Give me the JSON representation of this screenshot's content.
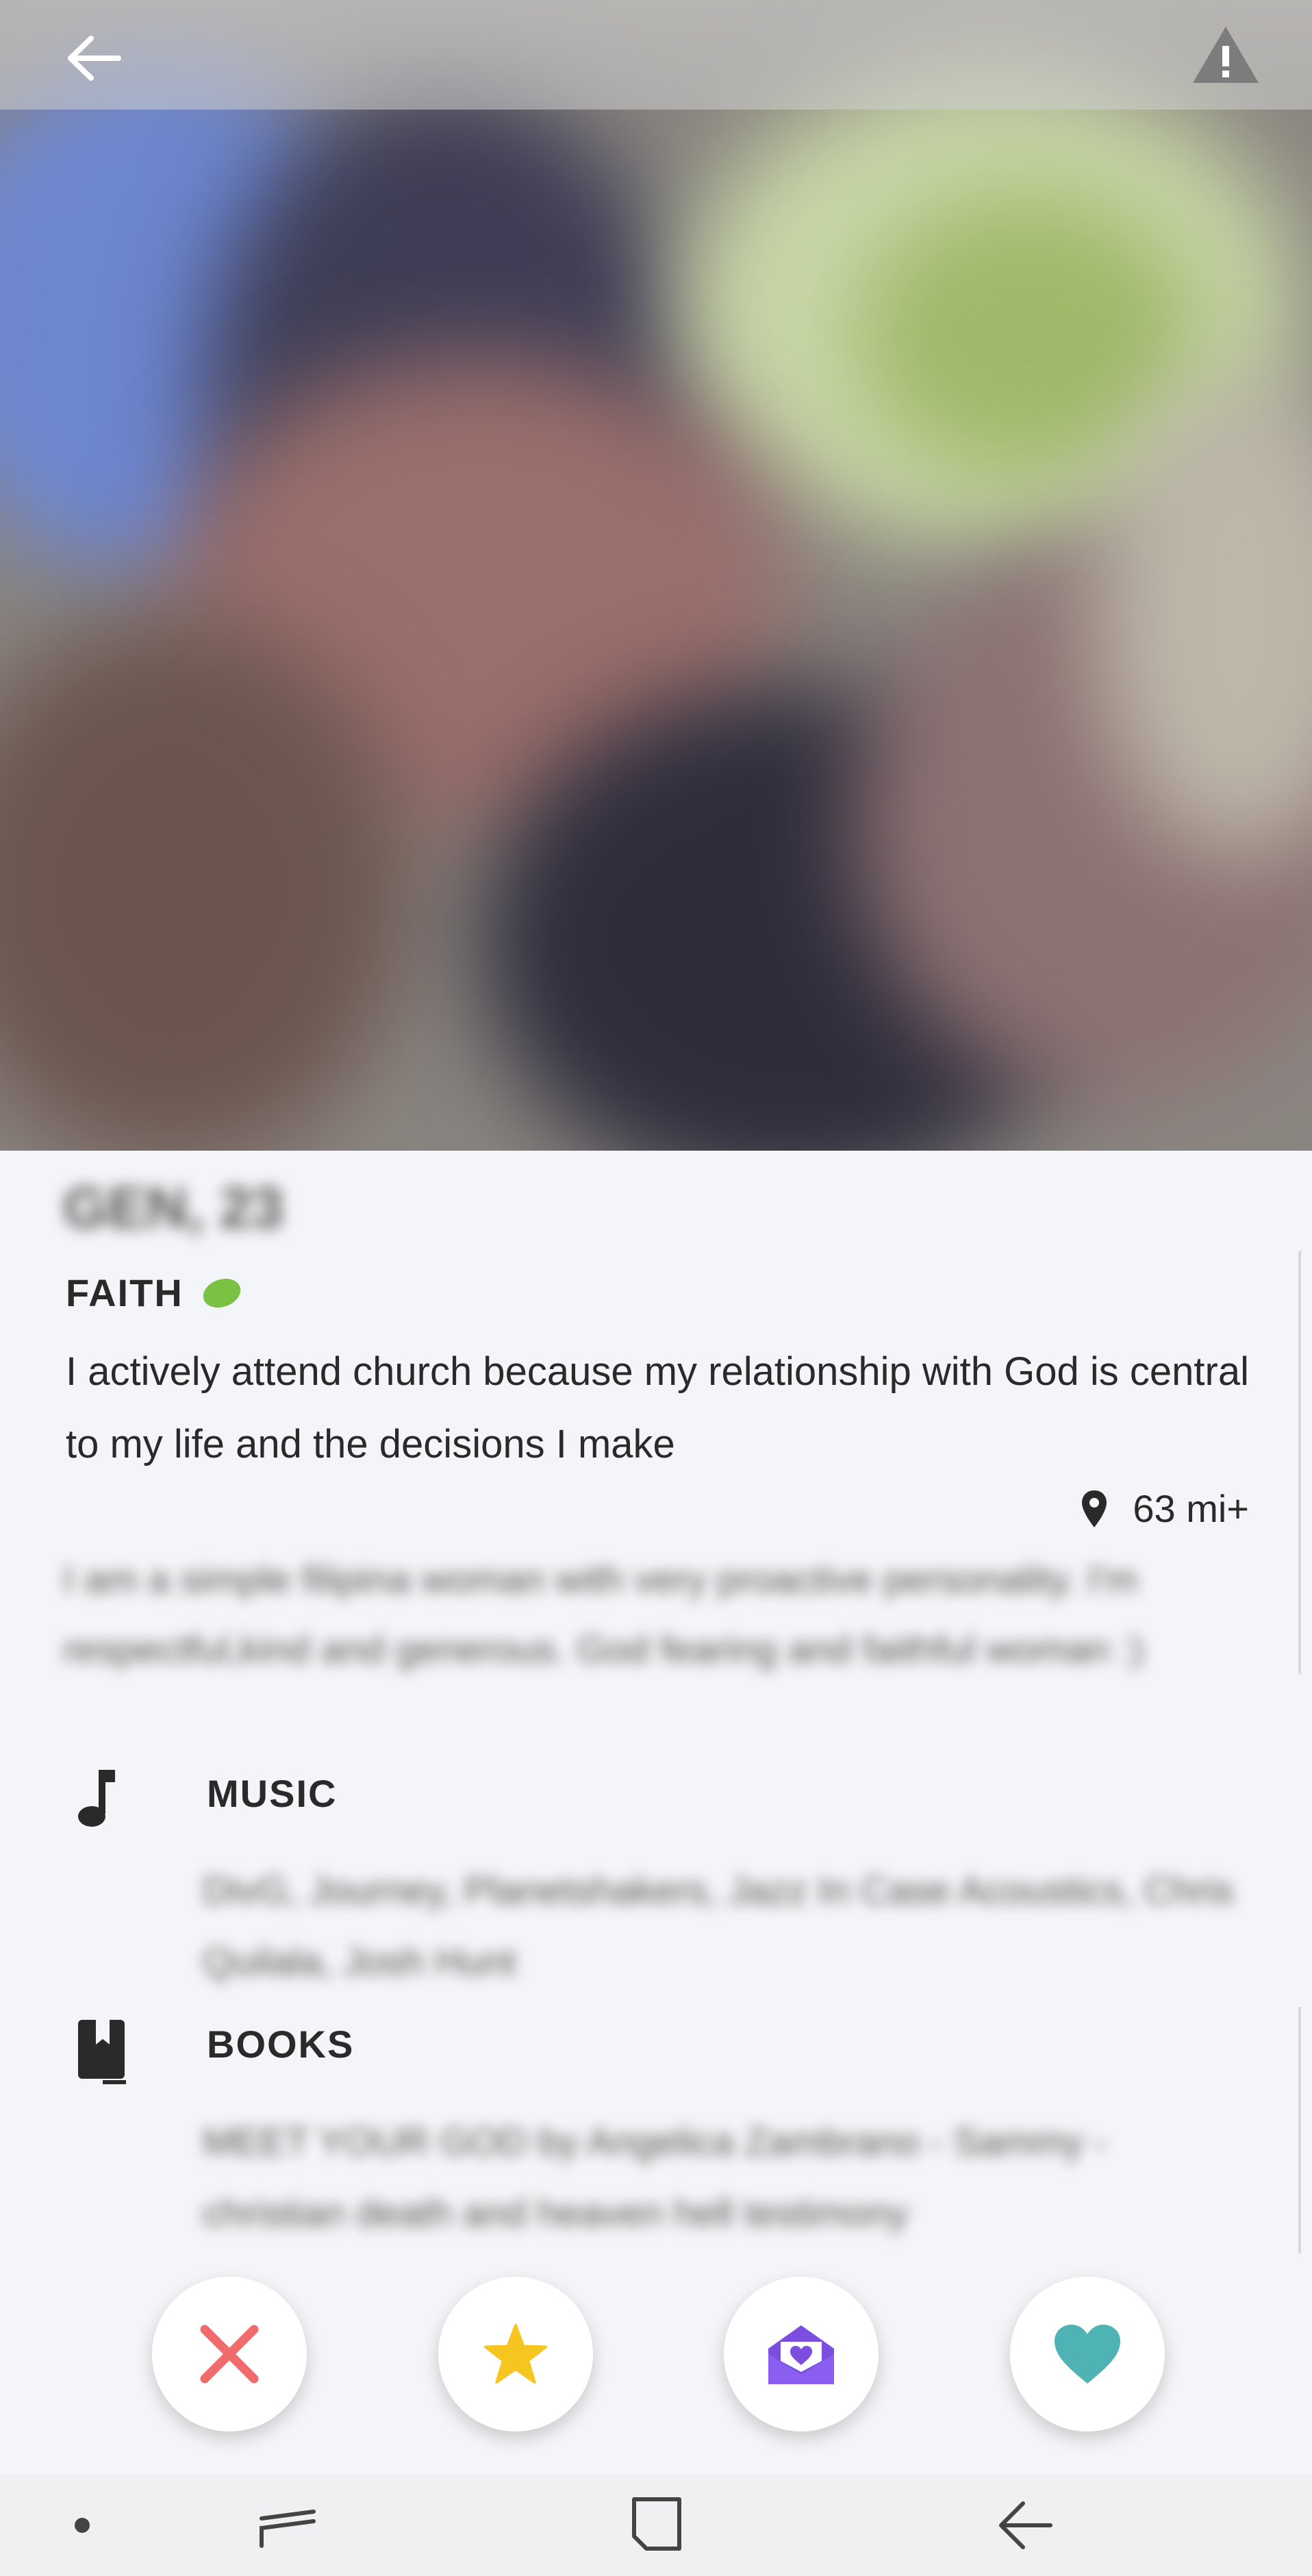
{
  "header": {
    "back_icon": "arrow-left-icon",
    "report_icon": "warning-triangle-icon"
  },
  "profile": {
    "name_age": "GEN, 23",
    "faith": {
      "label": "FAITH",
      "indicator_color": "#7bc142",
      "description": "I actively attend church because my relationship with God is central to my life and the decisions I make"
    },
    "distance": {
      "icon": "location-pin-icon",
      "text": "63 mi+"
    },
    "bio": "I am a simple filipina woman with very proactive personality. I'm respectful,kind and generous. God fearing and faithful woman :)",
    "sections": [
      {
        "icon": "music-note-icon",
        "title": "MUSIC",
        "body": "DivG, Journey, Planetshakers, Jazz In Case Acoustics, Chris Quilala, Josh Hunt"
      },
      {
        "icon": "book-icon",
        "title": "BOOKS",
        "body": "MEET YOUR GOD by Angelica Zambrano - Sammy - christian death and heaven hell testimony"
      }
    ]
  },
  "actions": [
    {
      "name": "pass-button",
      "icon": "x-icon",
      "color": "#f06b6b"
    },
    {
      "name": "super-like-button",
      "icon": "star-icon",
      "color": "#f7c520"
    },
    {
      "name": "message-button",
      "icon": "envelope-heart-icon",
      "color": "#7b4ee0"
    },
    {
      "name": "like-button",
      "icon": "heart-icon",
      "color": "#4fb3b5"
    }
  ],
  "system_nav": [
    {
      "name": "nav-dot",
      "icon": "dot-icon"
    },
    {
      "name": "recents-button",
      "icon": "recents-icon"
    },
    {
      "name": "home-button",
      "icon": "home-square-icon"
    },
    {
      "name": "back-button",
      "icon": "back-arrow-icon"
    }
  ]
}
